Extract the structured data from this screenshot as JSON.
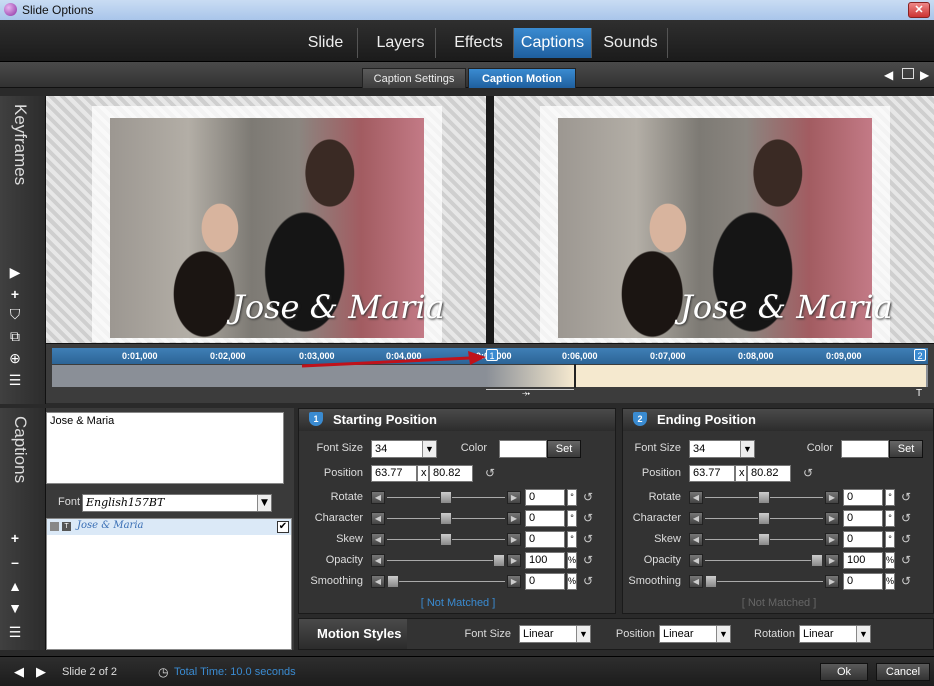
{
  "window": {
    "title": "Slide Options",
    "close_label": "✕"
  },
  "main_tabs": [
    {
      "label": "Slide"
    },
    {
      "label": "Layers"
    },
    {
      "label": "Effects"
    },
    {
      "label": "Captions"
    },
    {
      "label": "Sounds"
    }
  ],
  "active_main_tab": "Captions",
  "sub_tabs": [
    {
      "label": "Caption Settings"
    },
    {
      "label": "Caption Motion"
    }
  ],
  "active_sub_tab": "Caption Motion",
  "keyframes_label": "Keyframes",
  "preview_caption": "Jose & Maria",
  "timeline": {
    "ticks": [
      "0:01,000",
      "0:02,000",
      "0:03,000",
      "0:04,000",
      "0:05,000",
      "0:06,000",
      "0:07,000",
      "0:08,000",
      "0:09,000"
    ],
    "kf_start": "1",
    "kf_end": "2"
  },
  "captions_label": "Captions",
  "caption_text": "Jose & Maria",
  "font_label": "Font",
  "font_value": "English157BT",
  "caption_list_item": "Jose & Maria",
  "start": {
    "header": "Starting Position",
    "badge": "1",
    "font_size_label": "Font Size",
    "font_size": "34",
    "color_label": "Color",
    "set_label": "Set",
    "position_label": "Position",
    "pos_x": "63.77",
    "pos_sep": "x",
    "pos_y": "80.82",
    "rows": [
      {
        "label": "Rotate",
        "value": "0",
        "unit": "°",
        "thumb": 0.5
      },
      {
        "label": "Character",
        "value": "0",
        "unit": "°",
        "thumb": 0.5
      },
      {
        "label": "Skew",
        "value": "0",
        "unit": "°",
        "thumb": 0.5
      },
      {
        "label": "Opacity",
        "value": "100",
        "unit": "%",
        "thumb": 1.0
      },
      {
        "label": "Smoothing",
        "value": "0",
        "unit": "%",
        "thumb": 0.0
      }
    ],
    "match": "[ Not Matched ]"
  },
  "end": {
    "header": "Ending Position",
    "badge": "2",
    "font_size_label": "Font Size",
    "font_size": "34",
    "color_label": "Color",
    "set_label": "Set",
    "position_label": "Position",
    "pos_x": "63.77",
    "pos_sep": "x",
    "pos_y": "80.82",
    "rows": [
      {
        "label": "Rotate",
        "value": "0",
        "unit": "°",
        "thumb": 0.5
      },
      {
        "label": "Character",
        "value": "0",
        "unit": "°",
        "thumb": 0.5
      },
      {
        "label": "Skew",
        "value": "0",
        "unit": "°",
        "thumb": 0.5
      },
      {
        "label": "Opacity",
        "value": "100",
        "unit": "%",
        "thumb": 1.0
      },
      {
        "label": "Smoothing",
        "value": "0",
        "unit": "%",
        "thumb": 0.0
      }
    ],
    "match": "[ Not Matched ]"
  },
  "motion": {
    "title": "Motion Styles",
    "font_size_label": "Font Size",
    "font_size_value": "Linear",
    "position_label": "Position",
    "position_value": "Linear",
    "rotation_label": "Rotation",
    "rotation_value": "Linear"
  },
  "footer": {
    "slide_info": "Slide 2 of 2",
    "total_time": "Total Time: 10.0 seconds",
    "ok": "Ok",
    "cancel": "Cancel"
  },
  "colors": {
    "accent": "#3a8bd1",
    "timeline_fill": "#f5e9cf",
    "arrow": "#c0121a"
  }
}
